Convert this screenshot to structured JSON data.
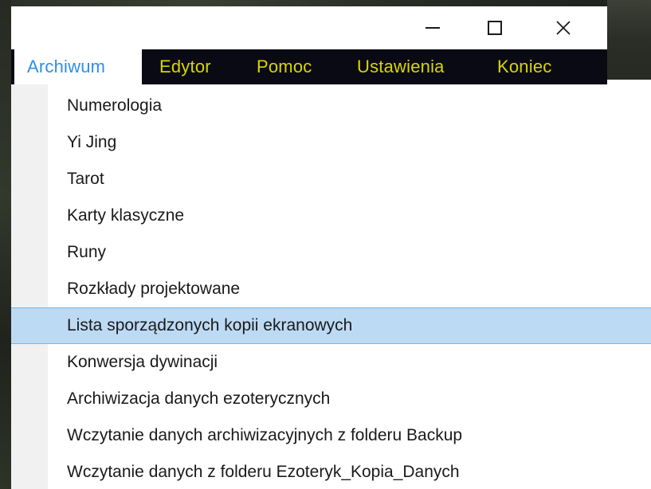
{
  "window": {
    "minimize_icon": "minimize-icon",
    "maximize_icon": "maximize-icon",
    "close_icon": "close-icon",
    "close_glyph": "✕"
  },
  "menubar": {
    "items": [
      {
        "label": "Archiwum"
      },
      {
        "label": "Edytor"
      },
      {
        "label": "Pomoc"
      },
      {
        "label": "Ustawienia"
      },
      {
        "label": "Koniec"
      }
    ],
    "active": "Archiwum",
    "text_color": "#d8d600",
    "active_text_color": "#2f8fe8",
    "bar_color": "#0a0a14"
  },
  "dropdown": {
    "items": [
      {
        "label": "Numerologia"
      },
      {
        "label": "Yi Jing"
      },
      {
        "label": "Tarot"
      },
      {
        "label": "Karty klasyczne"
      },
      {
        "label": "Runy"
      },
      {
        "label": "Rozkłady projektowane"
      },
      {
        "label": "Lista sporządzonych kopii ekranowych"
      },
      {
        "label": "Konwersja dywinacji"
      },
      {
        "label": "Archiwizacja danych ezoterycznych"
      },
      {
        "label": "Wczytanie danych archiwizacyjnych z folderu Backup"
      },
      {
        "label": "Wczytanie danych z folderu Ezoteryk_Kopia_Danych"
      }
    ],
    "highlighted": "Lista sporządzonych kopii ekranowych",
    "highlight_color": "#bcdaf3"
  }
}
